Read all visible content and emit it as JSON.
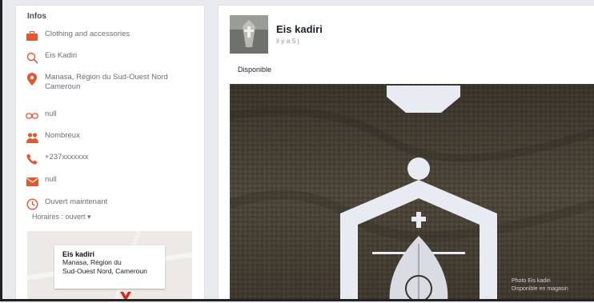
{
  "info": {
    "title": "Infos",
    "category": "Clothing and accessories",
    "name": "Eis Kadiri",
    "address": "Manasa, Région du Sud-Ouest Nord Cameroun",
    "website": "null",
    "followers": "Nombreux",
    "phone": "+237xxxxxxx",
    "email": "null",
    "hours": "Ouvert maintenant",
    "hours_sub": "Horaires : ouvert ▾"
  },
  "map": {
    "name": "Eis kadiri",
    "address_line1": "Manasa, Région du",
    "address_line2": "Sud-Ouest Nord, Cameroun"
  },
  "post": {
    "author": "Eis kadiri",
    "time": "il y a 5 j",
    "caption": "Disponible",
    "watermark_line1": "Photo Eis kadiri",
    "watermark_line2": "Disponible en magasin"
  },
  "colors": {
    "accent": "#e4572e",
    "fabric": "#4a4436",
    "embroidery": "#e8ecf2"
  }
}
